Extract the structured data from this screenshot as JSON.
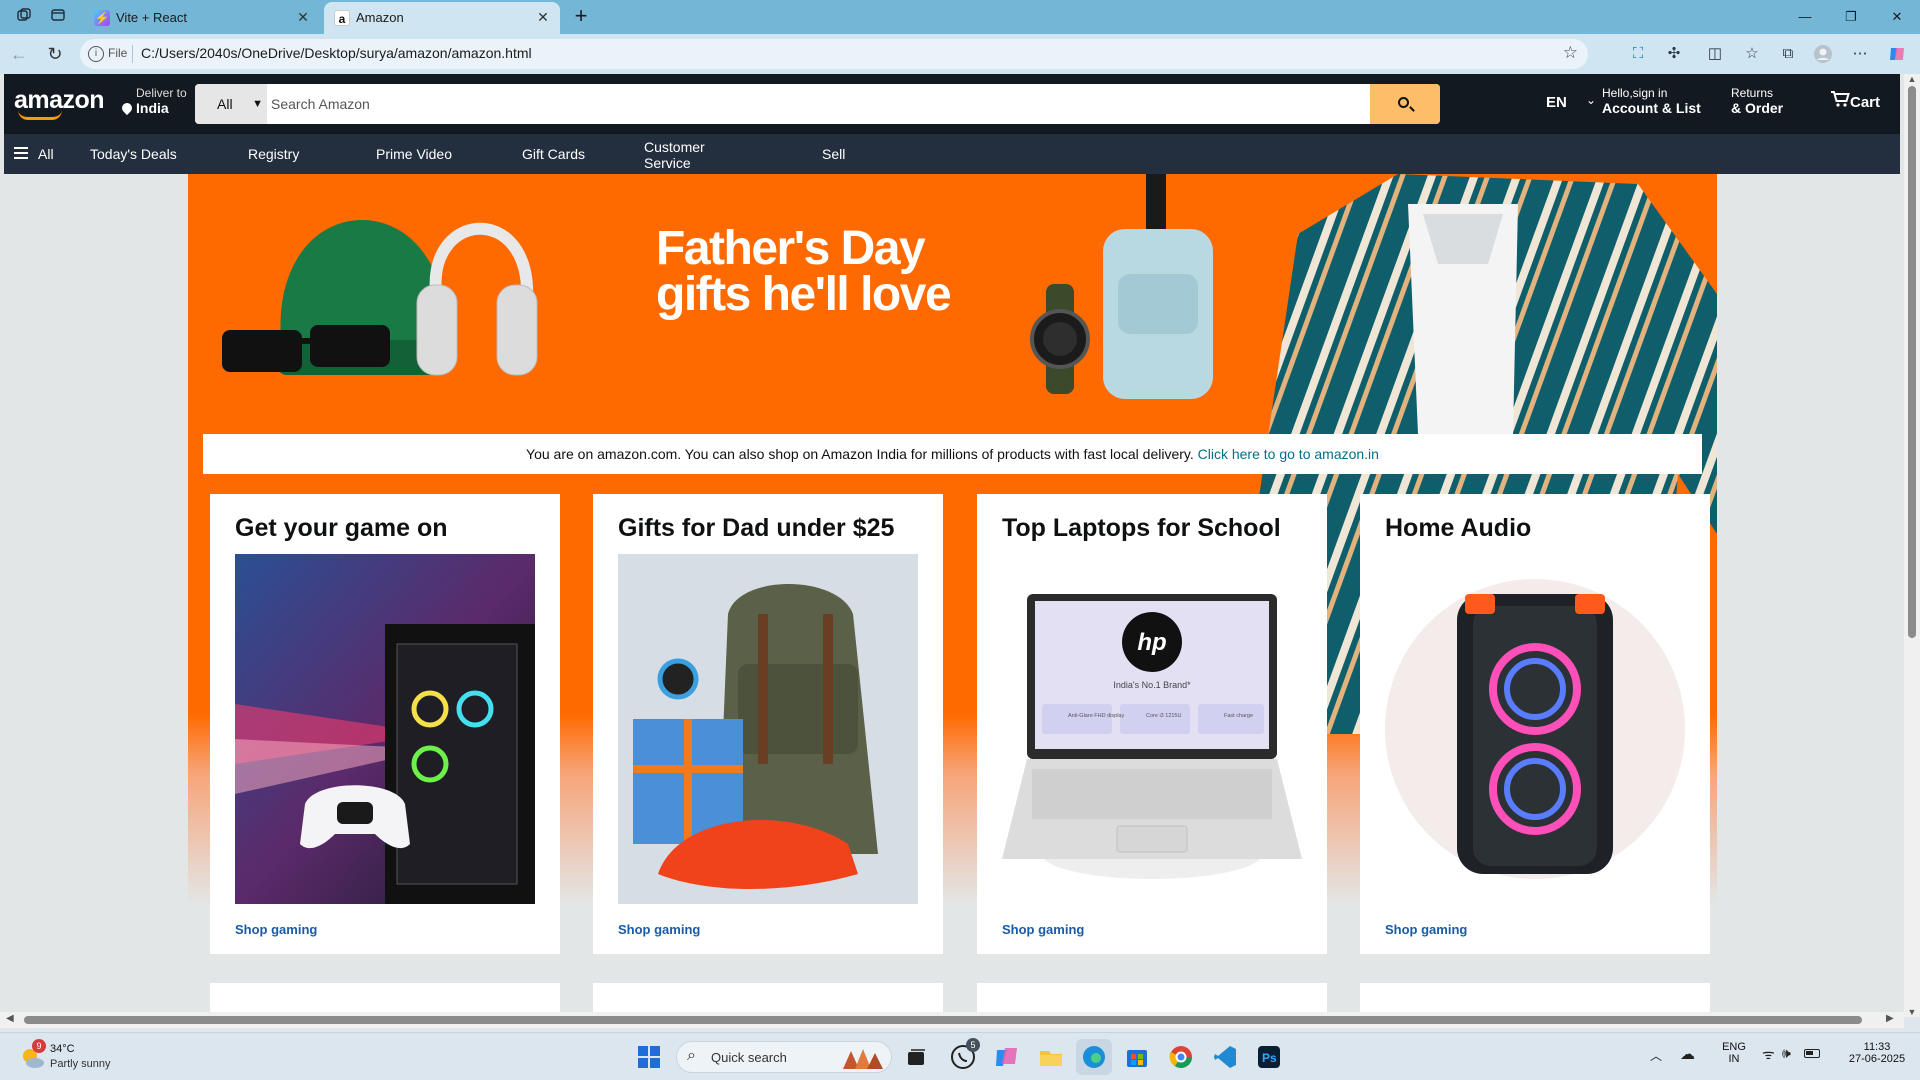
{
  "browser": {
    "tabs": [
      {
        "title": "Vite + React"
      },
      {
        "title": "Amazon"
      }
    ],
    "url_scheme": "File",
    "url": "C:/Users/2040s/OneDrive/Desktop/surya/amazon/amazon.html"
  },
  "header": {
    "logo": "amazon",
    "deliver_line1": "Deliver to",
    "deliver_line2": "India",
    "search_category": "All",
    "search_placeholder": "Search Amazon",
    "language": "EN",
    "account_line1": "Hello,sign in",
    "account_line2": "Account & List",
    "orders_line1": "Returns",
    "orders_line2": "& Order",
    "cart": "Cart"
  },
  "nav": {
    "all": "All",
    "items": [
      "Today's Deals",
      "Registry",
      "Prime Video",
      "Gift Cards",
      "Customer Service",
      "Sell"
    ]
  },
  "hero": {
    "title_line1": "Father's Day",
    "title_line2": "gifts he'll love"
  },
  "notice": {
    "text": "You are on amazon.com. You can also shop on Amazon India for millions of products with fast local delivery.",
    "link": "Click here to go to amazon.in"
  },
  "cards": [
    {
      "title": "Get your game on",
      "link": "Shop gaming"
    },
    {
      "title": "Gifts for Dad under $25",
      "link": "Shop gaming"
    },
    {
      "title": "Top Laptops for School",
      "link": "Shop gaming"
    },
    {
      "title": "Home Audio",
      "link": "Shop gaming"
    }
  ],
  "laptop_screen": {
    "logo": "hp",
    "tagline": "India's No.1 Brand*",
    "feature1": "Anti-Glare FHD display",
    "feature2": "Core i3 1215U",
    "feature3": "Fast charge"
  },
  "taskbar": {
    "weather_temp": "34°C",
    "weather_desc": "Partly sunny",
    "weather_badge": "9",
    "search_placeholder": "Quick search",
    "whatsapp_badge": "5",
    "lang_top": "ENG",
    "lang_bottom": "IN",
    "time": "11:33",
    "date": "27-06-2025"
  }
}
